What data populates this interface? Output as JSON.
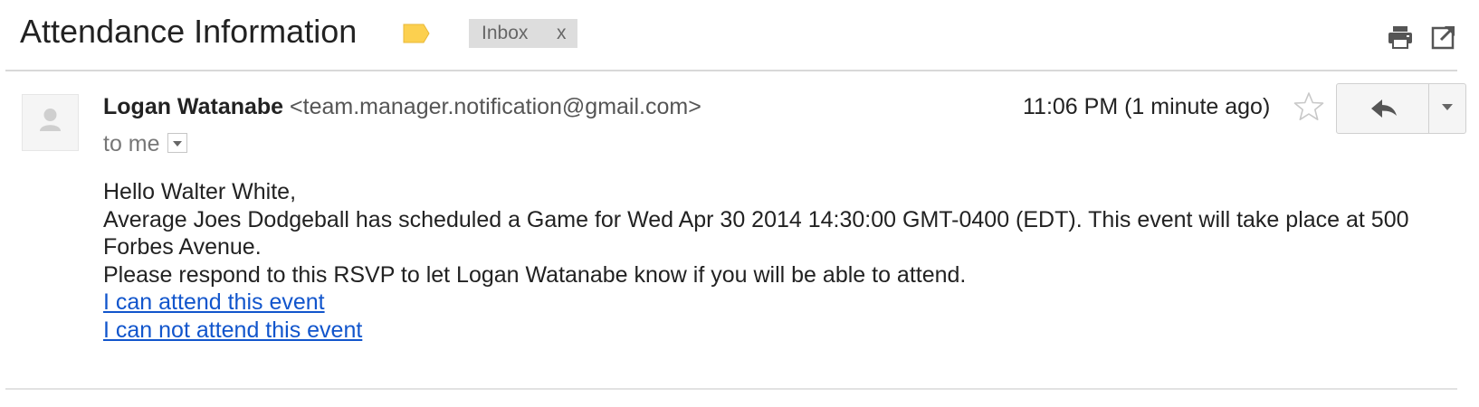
{
  "email": {
    "subject": "Attendance Information",
    "label": {
      "name": "Inbox",
      "remove": "x",
      "tag_color": "#fcd04f"
    },
    "sender": {
      "name": "Logan Watanabe",
      "email": "<team.manager.notification@gmail.com>"
    },
    "recipient_text": "to me",
    "time": "11:06 PM (1 minute ago)",
    "body": {
      "greeting": "Hello Walter White,",
      "line1": "Average Joes Dodgeball has scheduled a Game for Wed Apr 30 2014 14:30:00 GMT-0400 (EDT). This event will take place at 500 Forbes Avenue.",
      "line2": "Please respond to this RSVP to let Logan Watanabe know if you will be able to attend.",
      "link_attend": "I can attend this event",
      "link_not_attend": "I can not attend this event"
    }
  },
  "icons": {
    "print": "printer-icon",
    "popout": "new-window-icon",
    "star": "star-outline-icon",
    "reply": "reply-arrow-icon",
    "more": "chevron-down-icon",
    "avatar": "person-silhouette-icon",
    "label": "label-tag-icon"
  },
  "colors": {
    "link": "#1155cc",
    "label_tag": "#fcd04f",
    "chip_bg": "#dddddd"
  }
}
